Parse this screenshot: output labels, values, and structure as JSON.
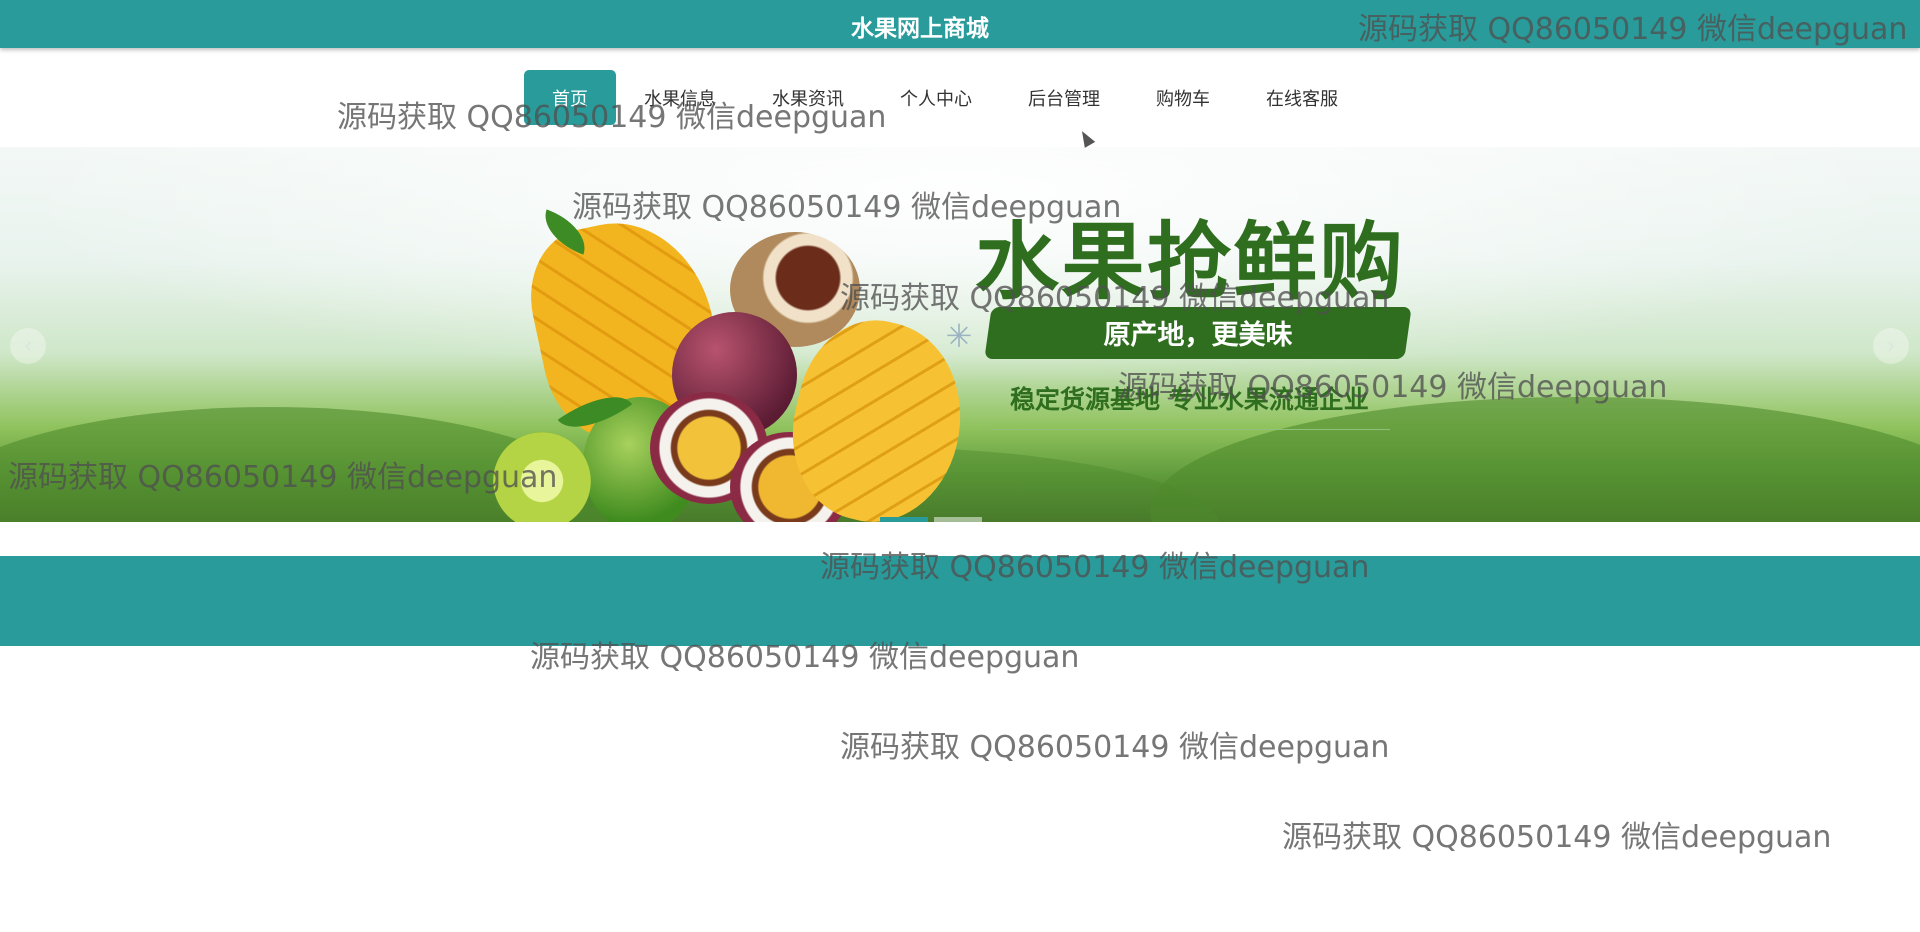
{
  "header": {
    "site_title": "水果网上商城"
  },
  "nav": {
    "items": [
      {
        "label": "首页",
        "active": true
      },
      {
        "label": "水果信息",
        "active": false
      },
      {
        "label": "水果资讯",
        "active": false
      },
      {
        "label": "个人中心",
        "active": false
      },
      {
        "label": "后台管理",
        "active": false
      },
      {
        "label": "购物车",
        "active": false
      },
      {
        "label": "在线客服",
        "active": false
      }
    ]
  },
  "banner": {
    "headline": "水果抢鲜购",
    "subheadline": "原产地，更美味",
    "tagline": "稳定货源基地 专业水果流通企业",
    "prev_icon": "chevron-left-icon",
    "next_icon": "chevron-right-icon"
  },
  "watermark": {
    "text": "源码获取 QQ86050149 微信deepguan"
  },
  "colors": {
    "accent": "#2a9b9b",
    "headline_green": "#2f6e1f"
  }
}
